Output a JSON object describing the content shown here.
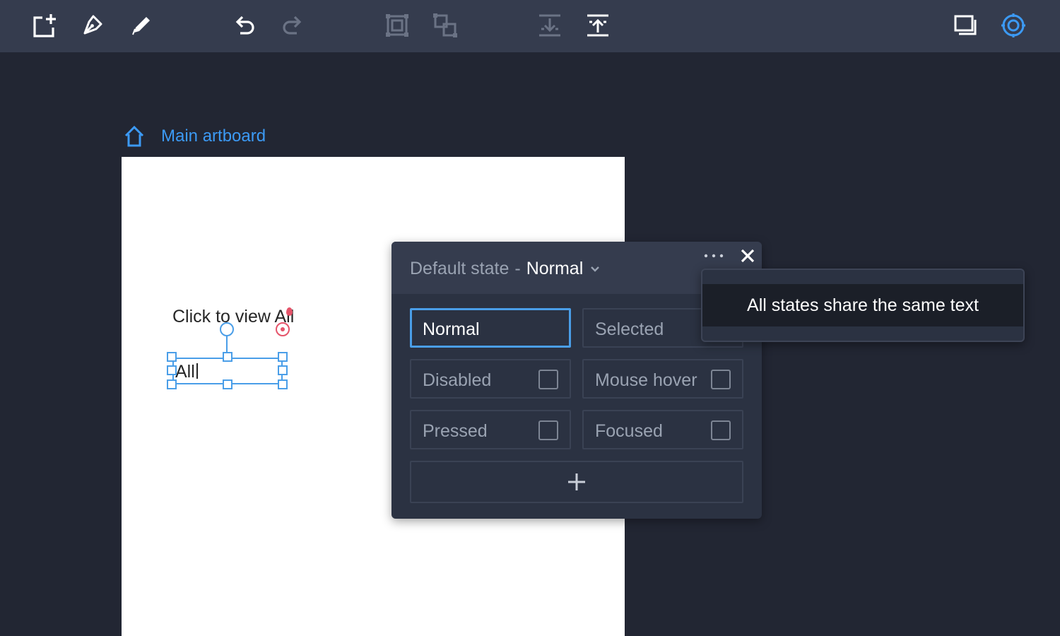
{
  "toolbar": {
    "left_tools": [
      {
        "name": "new-artboard-icon"
      },
      {
        "name": "pen-icon"
      },
      {
        "name": "pencil-icon"
      }
    ],
    "history": [
      {
        "name": "undo-icon",
        "enabled": true
      },
      {
        "name": "redo-icon",
        "enabled": false
      }
    ],
    "arrange": [
      {
        "name": "group-icon",
        "enabled": false
      },
      {
        "name": "ungroup-icon",
        "enabled": false
      }
    ],
    "layer": [
      {
        "name": "send-backward-icon",
        "enabled": false
      },
      {
        "name": "bring-forward-icon",
        "enabled": true
      }
    ],
    "right_tools": [
      {
        "name": "preview-window-icon"
      },
      {
        "name": "states-target-icon",
        "active": true
      }
    ]
  },
  "breadcrumb": {
    "icon": "home-icon",
    "label": "Main artboard"
  },
  "artboard": {
    "text_element": "Click to view All",
    "editing_text": "All"
  },
  "state_panel": {
    "title_prefix": "Default state",
    "title_separator": "-",
    "current_state": "Normal",
    "states": [
      {
        "label": "Normal",
        "active": true,
        "has_checkbox": false
      },
      {
        "label": "Selected",
        "active": false,
        "has_checkbox": false
      },
      {
        "label": "Disabled",
        "active": false,
        "has_checkbox": true,
        "checked": false
      },
      {
        "label": "Mouse hover",
        "active": false,
        "has_checkbox": true,
        "checked": false
      },
      {
        "label": "Pressed",
        "active": false,
        "has_checkbox": true,
        "checked": false
      },
      {
        "label": "Focused",
        "active": false,
        "has_checkbox": true,
        "checked": false
      }
    ],
    "add_icon": "plus-icon"
  },
  "menu": {
    "items": [
      {
        "label": "All states share the same text"
      }
    ]
  },
  "colors": {
    "background": "#222633",
    "toolbar": "#353c4e",
    "accent": "#3c9af5",
    "selection": "#4a9ee8",
    "pin": "#e5546a"
  }
}
